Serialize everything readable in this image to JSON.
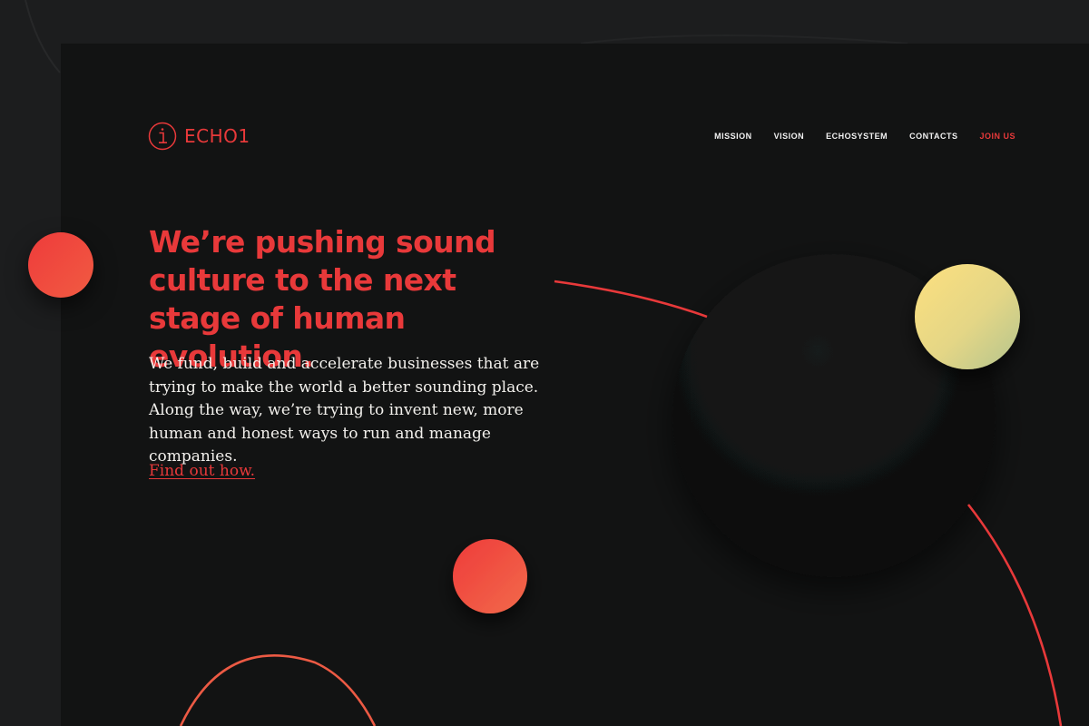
{
  "brand": {
    "name": "ECHO1",
    "logo_icon": "echo1-logo-icon",
    "accent_color": "#e8393a"
  },
  "nav": {
    "items": [
      {
        "label": "MISSION"
      },
      {
        "label": "VISION"
      },
      {
        "label": "ECHOSYSTEM"
      },
      {
        "label": "CONTACTS"
      },
      {
        "label": "JOIN US"
      }
    ]
  },
  "hero": {
    "headline": "We’re pushing sound culture to the next stage of human evolution.",
    "body": "We fund, build and accelerate businesses that are trying to make the world a better sounding place. Along the way, we’re trying to invent new, more human and honest ways to run and manage companies.",
    "cta": "Find out how."
  },
  "colors": {
    "page_background": "#1c1d1e",
    "frame_background": "#121313",
    "headline": "#e8393a",
    "body_text": "#f2f0ec",
    "red_gradient": [
      "#ee3b3b",
      "#f15b42"
    ],
    "yellow_gradient": [
      "#fbdd7e",
      "#b9c78d"
    ],
    "lines": "#e8393a"
  }
}
